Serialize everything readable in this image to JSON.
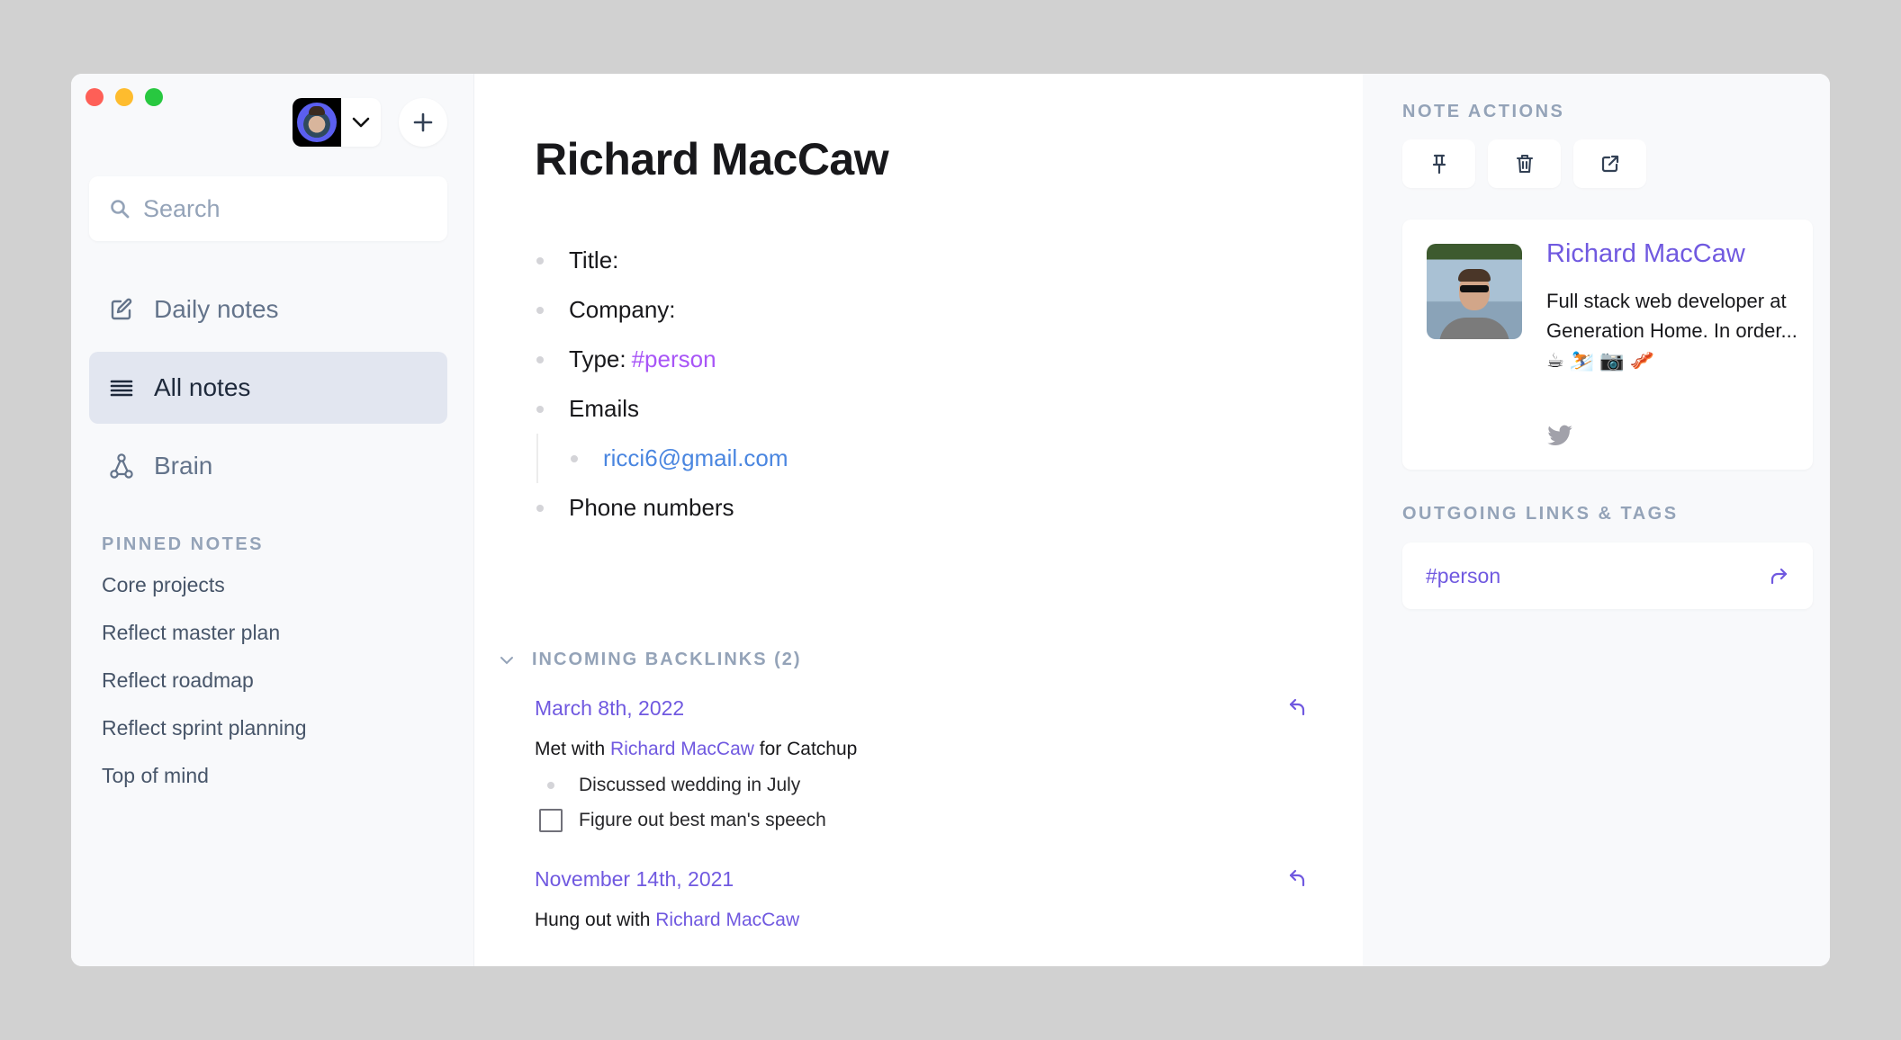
{
  "window": {
    "traffic_lights": [
      "close",
      "minimize",
      "maximize"
    ]
  },
  "sidebar": {
    "account_avatar": "user-avatar",
    "new_note_label": "+",
    "search": {
      "placeholder": "Search",
      "value": ""
    },
    "nav": [
      {
        "label": "Daily notes",
        "icon": "edit-icon",
        "active": false
      },
      {
        "label": "All notes",
        "icon": "list-icon",
        "active": true
      },
      {
        "label": "Brain",
        "icon": "graph-icon",
        "active": false
      }
    ],
    "pinned_title": "PINNED NOTES",
    "pinned": [
      "Core projects",
      "Reflect master plan",
      "Reflect roadmap",
      "Reflect sprint planning",
      "Top of mind"
    ]
  },
  "note": {
    "title": "Richard MacCaw",
    "properties": {
      "title_label": "Title:",
      "company_label": "Company:",
      "type_label": "Type:",
      "type_tag": "#person",
      "emails_label": "Emails",
      "email": "ricci6@gmail.com",
      "phones_label": "Phone numbers"
    },
    "backlinks": {
      "heading": "INCOMING BACKLINKS (2)",
      "items": [
        {
          "date": "March 8th, 2022",
          "text_before": "Met with ",
          "link": "Richard MacCaw",
          "text_after": " for Catchup",
          "bullet": "Discussed wedding in July",
          "task": "Figure out best man's speech",
          "task_checked": false
        },
        {
          "date": "November 14th, 2021",
          "text_before": "Hung out with ",
          "link": "Richard MacCaw",
          "text_after": ""
        }
      ]
    }
  },
  "right_panel": {
    "note_actions_title": "NOTE ACTIONS",
    "actions": [
      "pin-icon",
      "trash-icon",
      "external-link-icon"
    ],
    "profile": {
      "name": "Richard MacCaw",
      "bio": "Full stack web developer at Generation Home. In order... ☕ ⛷️ 📷 🥓",
      "social": "twitter-icon"
    },
    "outgoing_title": "OUTGOING LINKS & TAGS",
    "outgoing": [
      {
        "label": "#person"
      }
    ]
  },
  "colors": {
    "accent": "#7059e0",
    "tag": "#a855f7",
    "email": "#4a86e0",
    "muted": "#94a3b8",
    "sidebar_bg": "#f8f9fb",
    "active_nav": "#e2e6f0"
  }
}
